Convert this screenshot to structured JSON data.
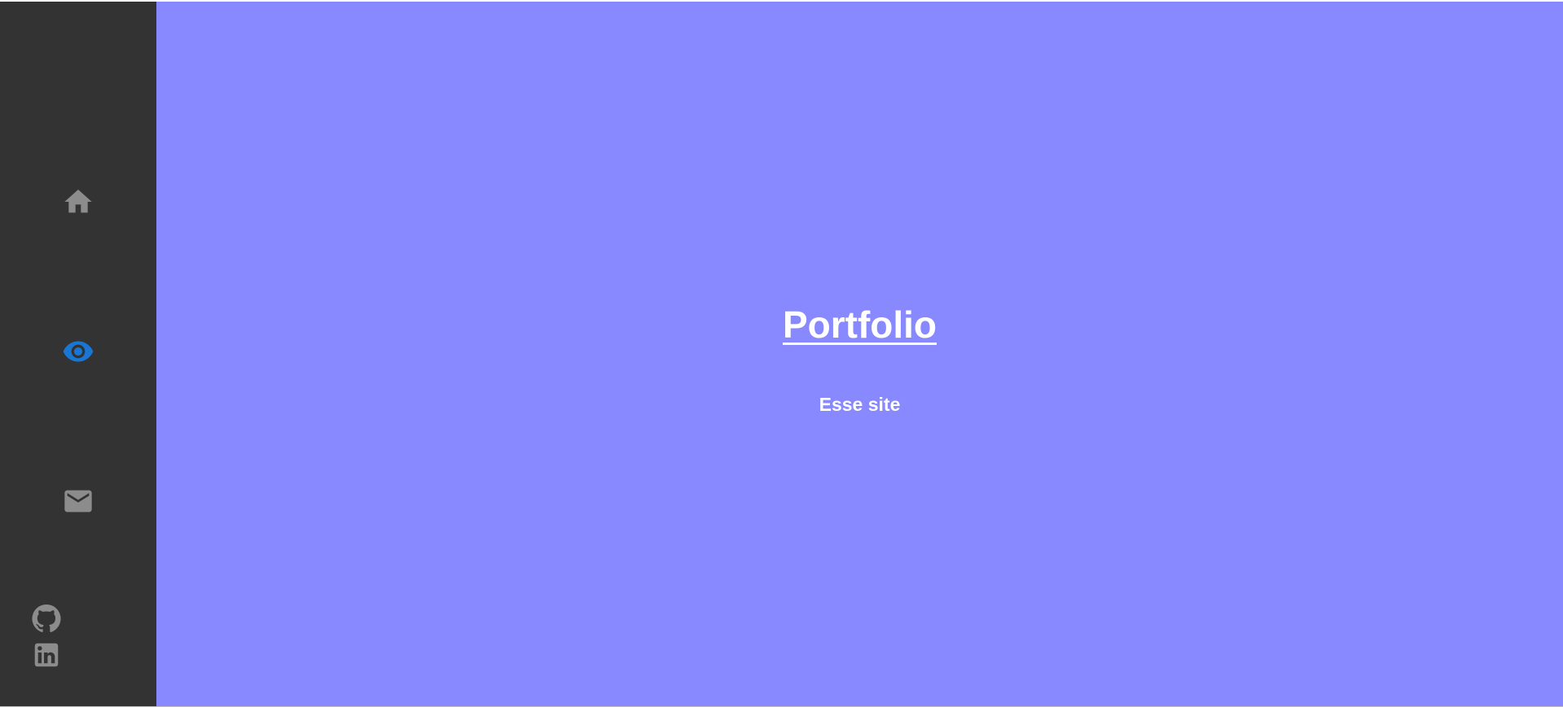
{
  "sidebar": {
    "nav": [
      {
        "name": "home",
        "icon": "home-icon",
        "active": false
      },
      {
        "name": "portfolio",
        "icon": "eye-icon",
        "active": true
      },
      {
        "name": "contact",
        "icon": "mail-icon",
        "active": false
      }
    ],
    "social": [
      {
        "name": "github",
        "icon": "github-icon"
      },
      {
        "name": "linkedin",
        "icon": "linkedin-icon"
      }
    ]
  },
  "main": {
    "title": "Portfolio",
    "subtitle": "Esse site"
  },
  "colors": {
    "sidebar_bg": "#333333",
    "main_bg": "#8889ff",
    "icon_inactive": "#8c8c8c",
    "icon_active": "#1976d2",
    "text": "#ffffff"
  }
}
